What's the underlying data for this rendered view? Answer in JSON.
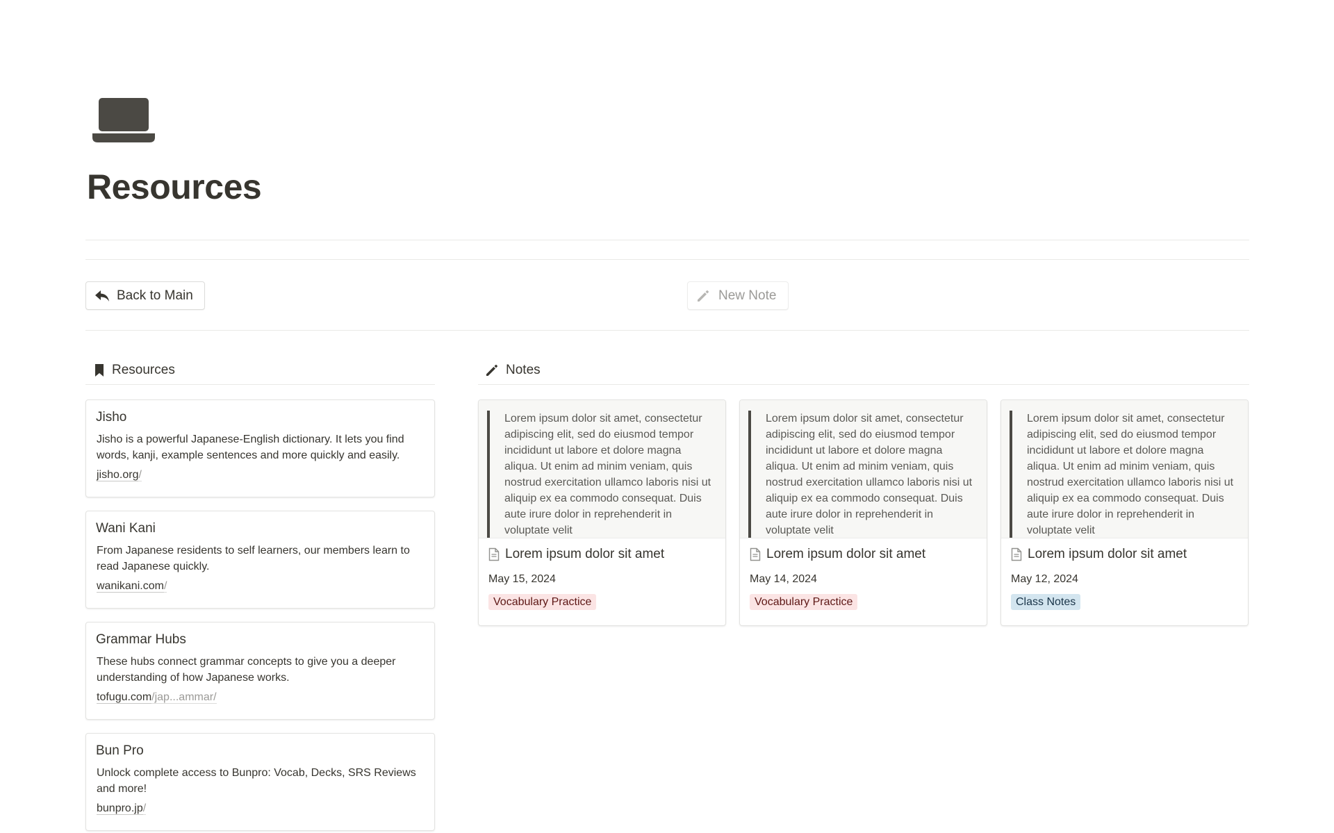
{
  "page": {
    "title": "Resources",
    "icon": "laptop-icon"
  },
  "toolbar": {
    "back_label": "Back to Main",
    "new_note_label": "New Note"
  },
  "resources_section": {
    "title": "Resources",
    "icon": "bookmark-icon"
  },
  "notes_section": {
    "title": "Notes",
    "icon": "pencil-icon"
  },
  "resources": [
    {
      "name": "Jisho",
      "description": "Jisho is a powerful Japanese-English dictionary. It lets you find words, kanji, example sentences and more quickly and easily.",
      "link_host": "jisho.org",
      "link_path": "/"
    },
    {
      "name": "Wani Kani",
      "description": "From Japanese residents to self learners, our members learn to read Japanese quickly.",
      "link_host": "wanikani.com",
      "link_path": "/"
    },
    {
      "name": "Grammar Hubs",
      "description": "These hubs connect grammar concepts to give you a deeper understanding of how Japanese works.",
      "link_host": "tofugu.com",
      "link_path": "/jap...ammar/"
    },
    {
      "name": "Bun Pro",
      "description": "Unlock complete access to Bunpro: Vocab, Decks, SRS Reviews and more!",
      "link_host": "bunpro.jp",
      "link_path": "/"
    }
  ],
  "notes": [
    {
      "preview": "Lorem ipsum dolor sit amet, consectetur adipiscing elit, sed do eiusmod tempor incididunt ut labore et dolore magna aliqua. Ut enim ad minim veniam, quis nostrud exercitation ullamco laboris nisi ut aliquip ex ea commodo consequat. Duis aute irure dolor in reprehenderit in voluptate velit",
      "title": "Lorem ipsum dolor sit amet",
      "date": "May 15, 2024",
      "tag": "Vocabulary Practice",
      "tag_color": "#fbe4e4"
    },
    {
      "preview": "Lorem ipsum dolor sit amet, consectetur adipiscing elit, sed do eiusmod tempor incididunt ut labore et dolore magna aliqua. Ut enim ad minim veniam, quis nostrud exercitation ullamco laboris nisi ut aliquip ex ea commodo consequat. Duis aute irure dolor in reprehenderit in voluptate velit",
      "title": "Lorem ipsum dolor sit amet",
      "date": "May 14, 2024",
      "tag": "Vocabulary Practice",
      "tag_color": "#fbe4e4"
    },
    {
      "preview": "Lorem ipsum dolor sit amet, consectetur adipiscing elit, sed do eiusmod tempor incididunt ut labore et dolore magna aliqua. Ut enim ad minim veniam, quis nostrud exercitation ullamco laboris nisi ut aliquip ex ea commodo consequat. Duis aute irure dolor in reprehenderit in voluptate velit",
      "title": "Lorem ipsum dolor sit amet",
      "date": "May 12, 2024",
      "tag": "Class Notes",
      "tag_color": "#d3e5ef"
    }
  ]
}
